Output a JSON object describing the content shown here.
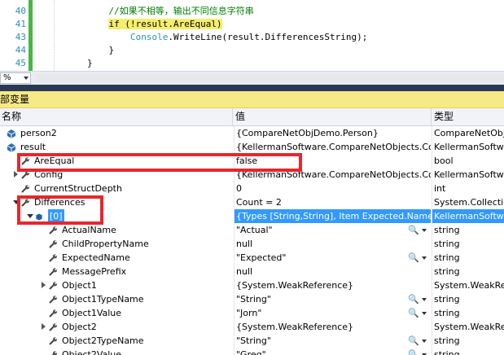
{
  "editor": {
    "lines": [
      {
        "num": "40",
        "parts": [
          {
            "t": "            ",
            "c": ""
          },
          {
            "t": "//如果不相等，输出不同信息字符串",
            "c": "cm"
          }
        ]
      },
      {
        "num": "41",
        "parts": [
          {
            "t": "            ",
            "c": ""
          },
          {
            "t": "if (!result.AreEqual)",
            "c": "hlkw"
          }
        ]
      },
      {
        "num": "43",
        "parts": [
          {
            "t": "                ",
            "c": ""
          },
          {
            "t": "Console",
            "c": "ty"
          },
          {
            "t": ".WriteLine(result.DifferencesString);",
            "c": ""
          }
        ]
      },
      {
        "num": "44",
        "parts": [
          {
            "t": "            }",
            "c": ""
          }
        ]
      },
      {
        "num": "45",
        "parts": [
          {
            "t": "        }",
            "c": ""
          }
        ]
      }
    ],
    "zoom": "%"
  },
  "panel": {
    "title": "部变量",
    "headers": {
      "name": "名称",
      "value": "值",
      "type": "类型"
    }
  },
  "rows": [
    {
      "name": "person2",
      "value": "{CompareNetObjDemo.Person}",
      "type": "CompareNetObj",
      "icon": "var-icon",
      "expander": ""
    },
    {
      "name": "result",
      "value": "{KellermanSoftware.CompareNetObjects.Con",
      "type": "KellermanSoftwa",
      "icon": "var-icon",
      "expander": ""
    },
    {
      "name": "AreEqual",
      "value": "false",
      "type": "bool",
      "icon": "property-icon",
      "expander": ""
    },
    {
      "name": "Config",
      "value": "{KellermanSoftware.CompareNetObjects.Con",
      "type": "KellermanSoftwa",
      "icon": "property-icon",
      "expander": "right"
    },
    {
      "name": "CurrentStructDepth",
      "value": "0",
      "type": "int",
      "icon": "property-icon",
      "expander": ""
    },
    {
      "name": "Differences",
      "value": "Count = 2",
      "type": "System.Collection",
      "icon": "property-icon",
      "expander": "down"
    },
    {
      "name": "[0]",
      "value": "{Types [String,String], Item Expected.Name !=",
      "type": "KellermanSoftwa",
      "icon": "object-icon",
      "expander": "down",
      "selected": true
    },
    {
      "name": "ActualName",
      "value": "\"Actual\"",
      "type": "string",
      "icon": "property-icon",
      "expander": "",
      "mag": true
    },
    {
      "name": "ChildPropertyName",
      "value": "null",
      "type": "string",
      "icon": "property-icon",
      "expander": ""
    },
    {
      "name": "ExpectedName",
      "value": "\"Expected\"",
      "type": "string",
      "icon": "property-icon",
      "expander": "",
      "mag": true
    },
    {
      "name": "MessagePrefix",
      "value": "null",
      "type": "string",
      "icon": "property-icon",
      "expander": ""
    },
    {
      "name": "Object1",
      "value": "{System.WeakReference}",
      "type": "System.WeakRef",
      "icon": "property-icon",
      "expander": "right"
    },
    {
      "name": "Object1TypeName",
      "value": "\"String\"",
      "type": "string",
      "icon": "property-icon",
      "expander": "",
      "mag": true
    },
    {
      "name": "Object1Value",
      "value": "\"Jorn\"",
      "type": "string",
      "icon": "property-icon",
      "expander": "",
      "mag": true
    },
    {
      "name": "Object2",
      "value": "{System.WeakReference}",
      "type": "System.WeakRef",
      "icon": "property-icon",
      "expander": "right"
    },
    {
      "name": "Object2TypeName",
      "value": "\"String\"",
      "type": "string",
      "icon": "property-icon",
      "expander": "",
      "mag": true
    },
    {
      "name": "Object2Value",
      "value": "\"Greg\"",
      "type": "string",
      "icon": "property-icon",
      "expander": "",
      "mag": true
    }
  ],
  "mag_glyph": "🔍",
  "colors": {
    "highlight_box": "#e8262d",
    "selection": "#3399ff",
    "panel_title": "#f6ea86"
  }
}
